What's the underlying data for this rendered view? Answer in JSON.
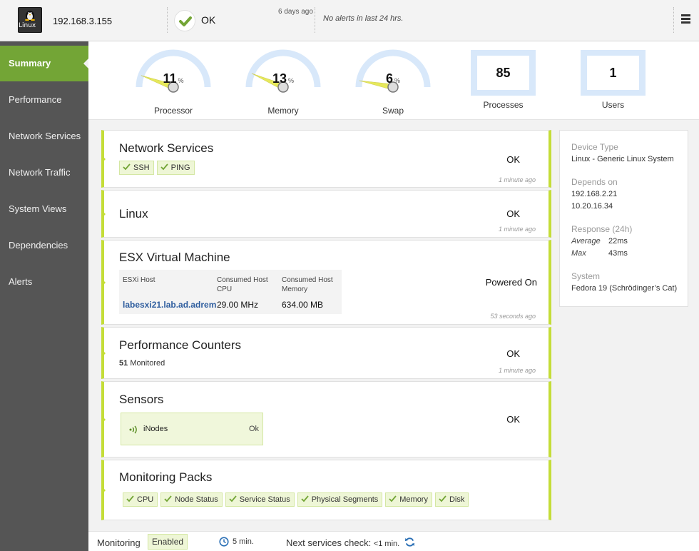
{
  "header": {
    "ip": "192.168.3.155",
    "logo_text": "Linux",
    "status": "OK",
    "status_age": "6 days ago",
    "alerts": "No alerts in last 24 hrs."
  },
  "sidebar": {
    "items": [
      {
        "label": "Summary",
        "active": true
      },
      {
        "label": "Performance"
      },
      {
        "label": "Network Services"
      },
      {
        "label": "Network Traffic"
      },
      {
        "label": "System Views"
      },
      {
        "label": "Dependencies"
      },
      {
        "label": "Alerts"
      }
    ]
  },
  "gauges": [
    {
      "label": "Processor",
      "value": "11",
      "unit": "%",
      "level": 0.11
    },
    {
      "label": "Memory",
      "value": "13",
      "unit": "%",
      "level": 0.13
    },
    {
      "label": "Swap",
      "value": "6",
      "unit": "%",
      "level": 0.06
    }
  ],
  "counters": [
    {
      "label": "Processes",
      "value": "85"
    },
    {
      "label": "Users",
      "value": "1"
    }
  ],
  "cards": {
    "network_services": {
      "title": "Network Services",
      "status": "OK",
      "time": "1 minute ago",
      "tags": [
        "SSH",
        "PING"
      ]
    },
    "linux": {
      "title": "Linux",
      "status": "OK",
      "time": "1 minute ago"
    },
    "esx": {
      "title": "ESX Virtual Machine",
      "status": "Powered On",
      "time": "53 seconds ago",
      "headers": [
        "ESXi Host",
        "Consumed Host CPU",
        "Consumed Host Memory"
      ],
      "values": [
        "labesxi21.lab.ad.adrem",
        "29.00 MHz",
        "634.00 MB"
      ]
    },
    "perf_counters": {
      "title": "Performance Counters",
      "status": "OK",
      "time": "1 minute ago",
      "count": "51",
      "count_label": "Monitored"
    },
    "sensors": {
      "title": "Sensors",
      "status": "OK",
      "sensor_name": "iNodes",
      "sensor_status": "Ok"
    },
    "monitoring_packs": {
      "title": "Monitoring Packs",
      "tags": [
        "CPU",
        "Node Status",
        "Service Status",
        "Physical Segments",
        "Memory",
        "Disk"
      ]
    }
  },
  "details": {
    "device_type_label": "Device Type",
    "device_type": "Linux - Generic Linux System",
    "depends_on_label": "Depends on",
    "depends_on": [
      "192.168.2.21",
      "10.20.16.34"
    ],
    "response_label": "Response (24h)",
    "average_label": "Average",
    "average": "22ms",
    "max_label": "Max",
    "max": "43ms",
    "system_label": "System",
    "system": "Fedora 19 (Schrödinger’s Cat)"
  },
  "footer": {
    "monitoring_label": "Monitoring",
    "monitoring_state": "Enabled",
    "interval": "5 min.",
    "next_check_label": "Next services check:",
    "next_check_value": "<1 min."
  },
  "colors": {
    "accent_green": "#73a536",
    "card_border": "#c4dd38",
    "gauge_track": "#d8e8fa",
    "gauge_needle": "#e6e85a",
    "sidebar_bg": "#555555",
    "link": "#2e5d9e"
  },
  "icons": {
    "status": "check-icon",
    "menu": "hamburger-icon",
    "sensor": "signal-icon",
    "interval": "clock-icon",
    "refresh": "refresh-icon"
  }
}
